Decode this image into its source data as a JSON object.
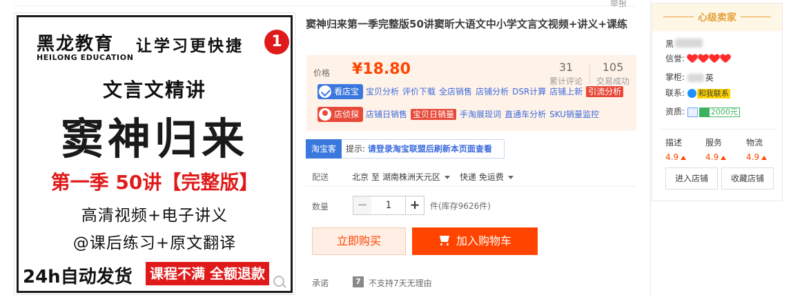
{
  "top": {
    "report": "举报"
  },
  "poster": {
    "brand_cn": "黑龙教育",
    "brand_en": "HEILONG EDUCATION",
    "slogan": "让学习更快捷",
    "badge": "1",
    "subtitle": "文言文精讲",
    "title": "窦神归来",
    "season": "第一季 50讲【完整版】",
    "line1": "高清视频+电子讲义",
    "line2": "@课后练习+原文翻译",
    "foot_left": "24h自动发货",
    "foot_right": "课程不满 全额退款"
  },
  "product": {
    "title": "窦神归来第一季完整版50讲窦昕大语文中小学文言文视频+讲义+课练"
  },
  "price": {
    "label": "价格",
    "value": "¥18.80",
    "stats": [
      {
        "num": "31",
        "label": "累计评论"
      },
      {
        "num": "105",
        "label": "交易成功"
      }
    ]
  },
  "tools": {
    "row1_badge": "看店宝",
    "row1_links": [
      "宝贝分析",
      "评价下载",
      "全店销售",
      "店铺分析",
      "DSR计算",
      "店铺上新"
    ],
    "row1_highlight": "引流分析",
    "row2_badge": "店侦探",
    "row2_link1": "店铺日销售",
    "row2_highlight": "宝贝日销量",
    "row2_links": [
      "手淘展现词",
      "直通车分析",
      "SKU销量监控"
    ]
  },
  "taobaoke": {
    "badge": "淘宝客",
    "prefix": "提示:",
    "message": "请登录淘宝联盟后刷新本页面查看"
  },
  "shipping": {
    "label": "配送",
    "from": "北京",
    "to_word": "至",
    "destination": "湖南株洲天元区",
    "method": "快递 免运费"
  },
  "quantity": {
    "label": "数量",
    "minus": "−",
    "value": "1",
    "plus": "+",
    "stock": "件(库存9626件)"
  },
  "actions": {
    "buy_now": "立即购买",
    "add_cart": "加入购物车"
  },
  "promise": {
    "label": "承诺",
    "icon_char": "7",
    "text": "不支持7天无理由"
  },
  "seller": {
    "heading": "心级卖家",
    "name_visible": "黑",
    "credit_label": "信誉:",
    "hearts": 4,
    "keeper_label": "掌柜:",
    "keeper_visible": "英",
    "contact_label": "联系:",
    "contact_tag": "和我联系",
    "qual_label": "资质:",
    "qual_amount": "2000元",
    "scores": [
      {
        "label": "描述",
        "value": "4.9"
      },
      {
        "label": "服务",
        "value": "4.9"
      },
      {
        "label": "物流",
        "value": "4.9"
      }
    ],
    "enter_shop": "进入店铺",
    "fav_shop": "收藏店铺"
  }
}
